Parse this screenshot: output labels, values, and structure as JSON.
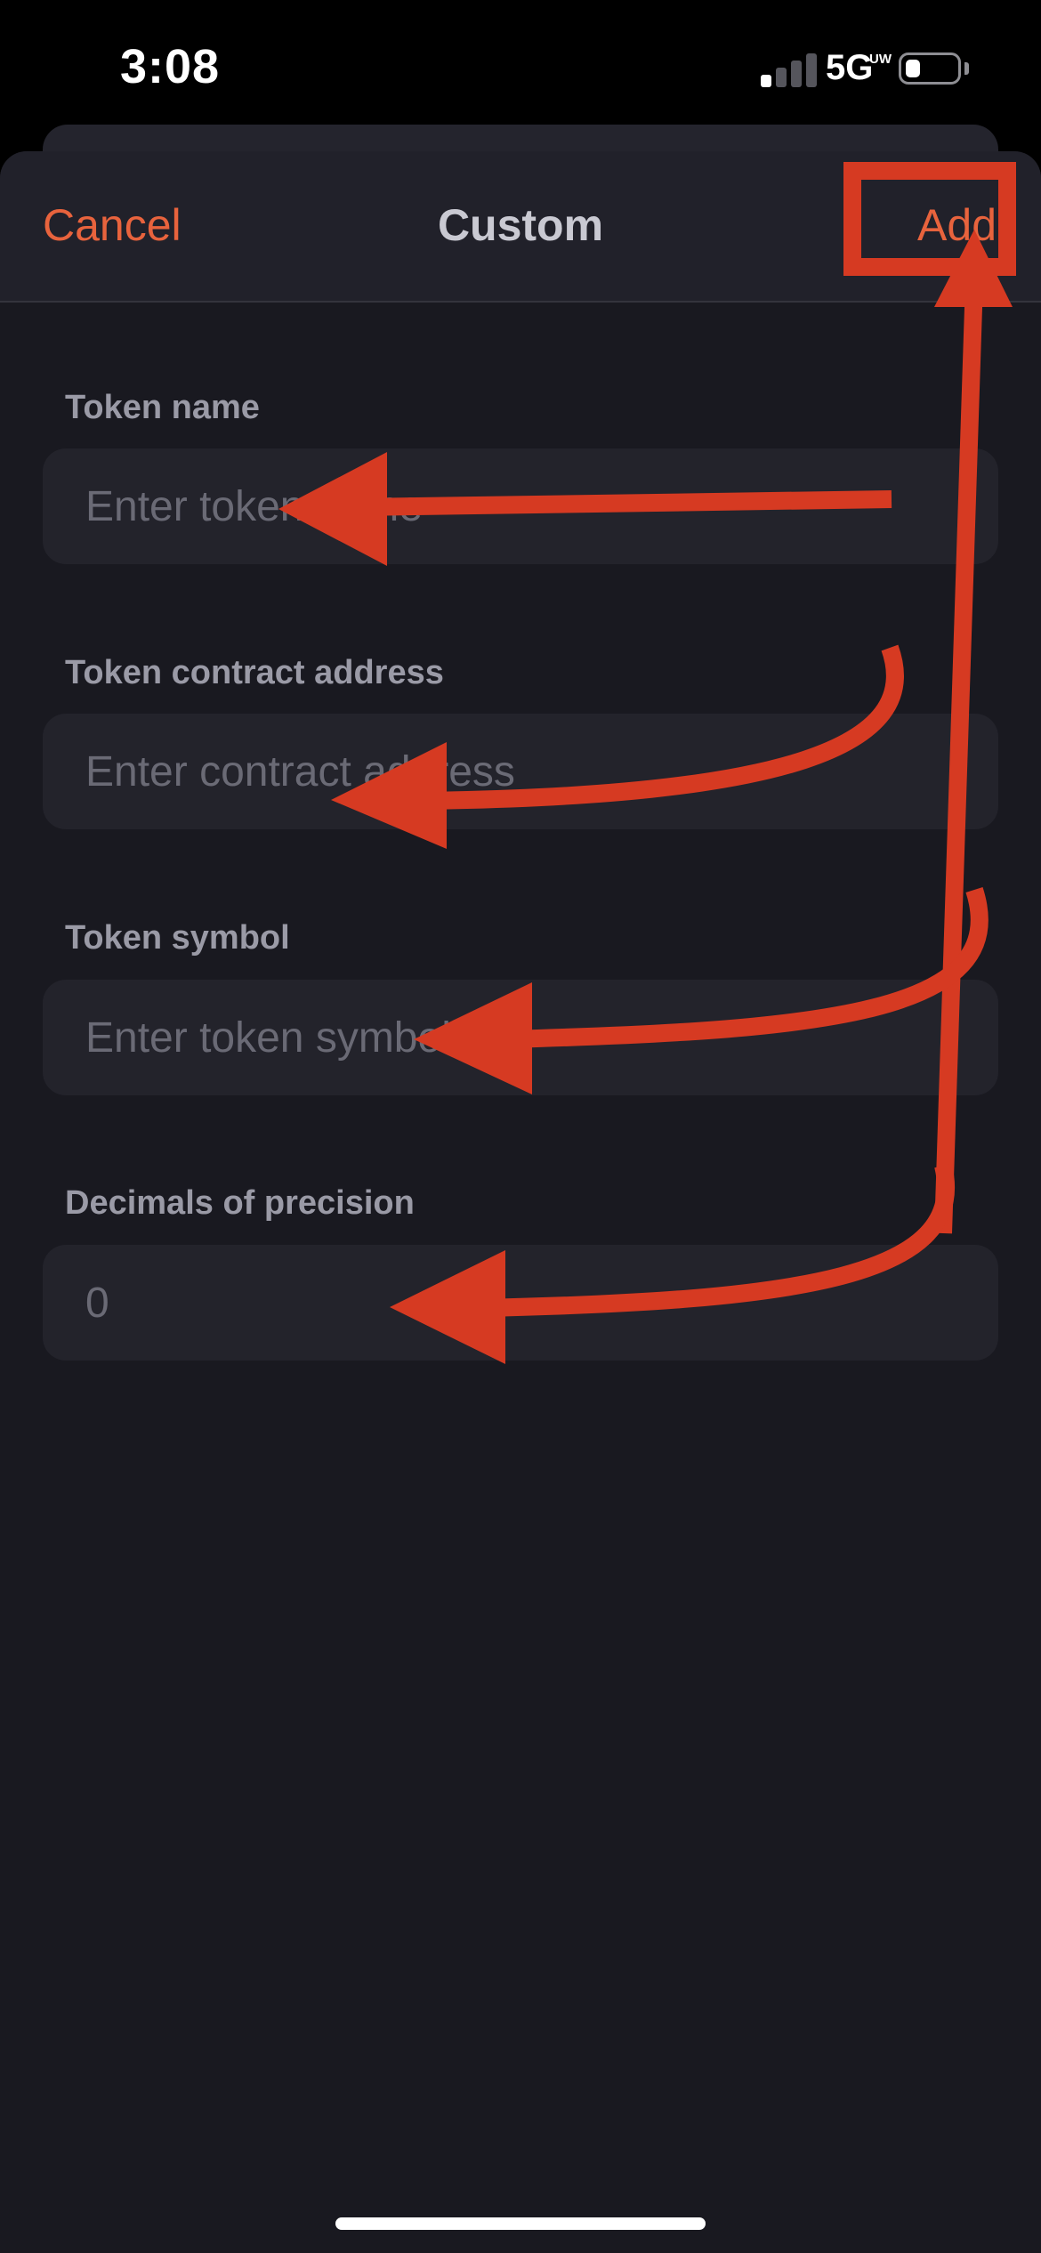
{
  "status_bar": {
    "time": "3:08",
    "network": "5G",
    "network_sub": "UW",
    "signal_bars_active": 1,
    "signal_bars_total": 4,
    "battery_level": 0.3
  },
  "nav": {
    "cancel_label": "Cancel",
    "title": "Custom",
    "add_label": "Add"
  },
  "form": {
    "fields": [
      {
        "label": "Token name",
        "placeholder": "Enter token name",
        "value": ""
      },
      {
        "label": "Token contract address",
        "placeholder": "Enter contract address",
        "value": ""
      },
      {
        "label": "Token symbol",
        "placeholder": "Enter token symbol",
        "value": ""
      },
      {
        "label": "Decimals of precision",
        "placeholder": "0",
        "value": ""
      }
    ]
  },
  "colors": {
    "accent": "#e8633d",
    "annotation": "#d63a22",
    "sheet_background": "#191920",
    "field_background": "#23232b"
  }
}
